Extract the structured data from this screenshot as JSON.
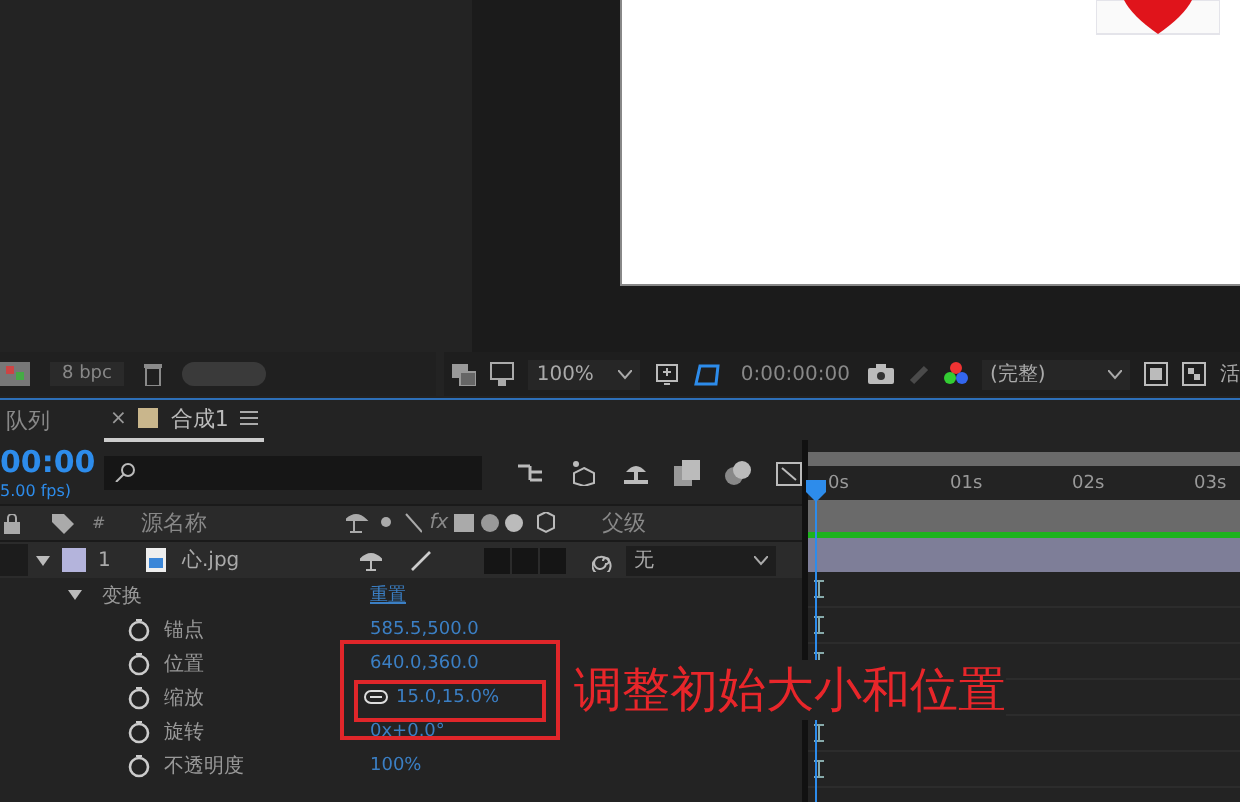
{
  "viewer": {
    "zoom": "100%",
    "timecode": "0:00:00:00",
    "resolution": "(完整)",
    "cut_label": "活"
  },
  "project": {
    "bit_depth": "8 bpc"
  },
  "tabs": [
    {
      "label": "队列",
      "selected": false
    },
    {
      "label": "合成1",
      "selected": true,
      "close_mark": "×",
      "color": "#c9b68c"
    }
  ],
  "timeline": {
    "timecode": "00:00",
    "fps": "5.00 fps)",
    "ruler": [
      "0s",
      "01s",
      "02s",
      "03s"
    ]
  },
  "columns": {
    "number": "#",
    "source_name": "源名称",
    "effects": "fx",
    "parent": "父级"
  },
  "layers": [
    {
      "number": "1",
      "name": "心.jpg",
      "color": "#b4b4dc",
      "expanded": true,
      "parent": "无"
    }
  ],
  "transform": {
    "label": "变换",
    "expanded": true,
    "reset": "重置",
    "properties": [
      {
        "name": "锚点",
        "value": "585.5,500.0",
        "linked": false
      },
      {
        "name": "位置",
        "value": "640.0,360.0",
        "linked": false
      },
      {
        "name": "缩放",
        "value": "15.0,15.0%",
        "linked": true
      },
      {
        "name": "旋转",
        "value": "0x+0.0°",
        "linked": false
      },
      {
        "name": "不透明度",
        "value": "100%",
        "linked": false
      }
    ]
  },
  "annotation": "调整初始大小和位置"
}
